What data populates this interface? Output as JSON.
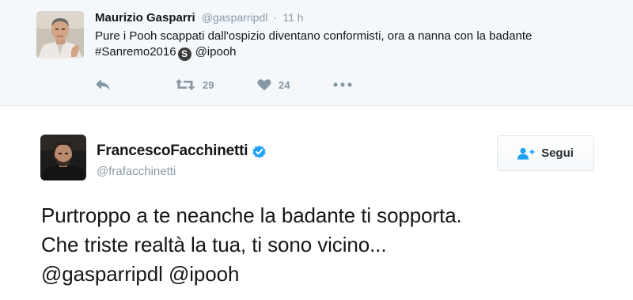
{
  "quoted_tweet": {
    "author_name": "Maurizio Gasparri",
    "handle": "@gasparripdl",
    "separator": "·",
    "time": "11 h",
    "text_part1": "Pure i Pooh scappati dall'ospizio diventano conformisti, ora a nanna con la badante #Sanremo2016",
    "badge_letter": "S",
    "text_part2": "@ipooh",
    "retweet_count": "29",
    "like_count": "24",
    "icons": {
      "reply": "reply-icon",
      "retweet": "retweet-icon",
      "like": "heart-icon",
      "more": "more-dots-icon"
    }
  },
  "main_tweet": {
    "author_name": "FrancescoFacchinetti",
    "handle": "@frafacchinetti",
    "follow_label": "Segui",
    "text_lines": [
      "Purtroppo a te neanche la badante ti sopporta.",
      "Che triste realtà la tua, ti sono vicino...",
      "@gasparripdl @ipooh"
    ],
    "icons": {
      "verified": "verified-badge-icon",
      "follow": "add-user-icon"
    }
  },
  "colors": {
    "muted": "#8899a6",
    "text": "#14171a",
    "verified_blue": "#1da1f2",
    "top_background": "#f5f8fa",
    "border": "#e1e8ed"
  }
}
